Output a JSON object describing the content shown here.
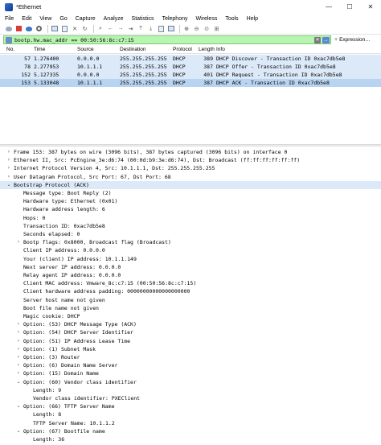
{
  "window": {
    "title": "*Ethernet",
    "controls": [
      "—",
      "☐",
      "✕"
    ]
  },
  "menu": [
    "File",
    "Edit",
    "View",
    "Go",
    "Capture",
    "Analyze",
    "Statistics",
    "Telephony",
    "Wireless",
    "Tools",
    "Help"
  ],
  "filter": {
    "value": "bootp.hw.mac_addr == 00:50:56:8c:c7:15",
    "expression_label": "Expression…",
    "clear_glyph": "✕",
    "apply_glyph": "→"
  },
  "packet_list": {
    "columns": [
      "No.",
      "Time",
      "Source",
      "Destination",
      "Protocol",
      "Length",
      "Info"
    ],
    "rows": [
      {
        "no": "57",
        "time": "1.276400",
        "src": "0.0.0.0",
        "dst": "255.255.255.255",
        "proto": "DHCP",
        "len": "389",
        "info": "DHCP Discover  - Transaction ID 0xac7db5e8",
        "selected": false
      },
      {
        "no": "78",
        "time": "2.277953",
        "src": "10.1.1.1",
        "dst": "255.255.255.255",
        "proto": "DHCP",
        "len": "387",
        "info": "DHCP Offer     - Transaction ID 0xac7db5e8",
        "selected": false
      },
      {
        "no": "152",
        "time": "5.127335",
        "src": "0.0.0.0",
        "dst": "255.255.255.255",
        "proto": "DHCP",
        "len": "401",
        "info": "DHCP Request   - Transaction ID 0xac7db5e8",
        "selected": false
      },
      {
        "no": "153",
        "time": "5.133048",
        "src": "10.1.1.1",
        "dst": "255.255.255.255",
        "proto": "DHCP",
        "len": "387",
        "info": "DHCP ACK       - Transaction ID 0xac7db5e8",
        "selected": true
      }
    ]
  },
  "details": [
    {
      "indent": 0,
      "arrow": "›",
      "text": "Frame 153: 387 bytes on wire (3096 bits), 387 bytes captured (3096 bits) on interface 0",
      "hl": false
    },
    {
      "indent": 0,
      "arrow": "›",
      "text": "Ethernet II, Src: PcEngine_3e:d6:74 (00:0d:b9:3e:d6:74), Dst: Broadcast (ff:ff:ff:ff:ff:ff)",
      "hl": false
    },
    {
      "indent": 0,
      "arrow": "›",
      "text": "Internet Protocol Version 4, Src: 10.1.1.1, Dst: 255.255.255.255",
      "hl": false
    },
    {
      "indent": 0,
      "arrow": "›",
      "text": "User Datagram Protocol, Src Port: 67, Dst Port: 68",
      "hl": false
    },
    {
      "indent": 0,
      "arrow": "⌄",
      "text": "Bootstrap Protocol (ACK)",
      "hl": true
    },
    {
      "indent": 1,
      "arrow": "",
      "text": "Message type: Boot Reply (2)",
      "hl": false
    },
    {
      "indent": 1,
      "arrow": "",
      "text": "Hardware type: Ethernet (0x01)",
      "hl": false
    },
    {
      "indent": 1,
      "arrow": "",
      "text": "Hardware address length: 6",
      "hl": false
    },
    {
      "indent": 1,
      "arrow": "",
      "text": "Hops: 0",
      "hl": false
    },
    {
      "indent": 1,
      "arrow": "",
      "text": "Transaction ID: 0xac7db5e8",
      "hl": false
    },
    {
      "indent": 1,
      "arrow": "",
      "text": "Seconds elapsed: 0",
      "hl": false
    },
    {
      "indent": 1,
      "arrow": "›",
      "text": "Bootp flags: 0x8000, Broadcast flag (Broadcast)",
      "hl": false
    },
    {
      "indent": 1,
      "arrow": "",
      "text": "Client IP address: 0.0.0.0",
      "hl": false
    },
    {
      "indent": 1,
      "arrow": "",
      "text": "Your (client) IP address: 10.1.1.149",
      "hl": false
    },
    {
      "indent": 1,
      "arrow": "",
      "text": "Next server IP address: 0.0.0.0",
      "hl": false
    },
    {
      "indent": 1,
      "arrow": "",
      "text": "Relay agent IP address: 0.0.0.0",
      "hl": false
    },
    {
      "indent": 1,
      "arrow": "",
      "text": "Client MAC address: Vmware_8c:c7:15 (00:50:56:8c:c7:15)",
      "hl": false
    },
    {
      "indent": 1,
      "arrow": "",
      "text": "Client hardware address padding: 00000000000000000000",
      "hl": false
    },
    {
      "indent": 1,
      "arrow": "",
      "text": "Server host name not given",
      "hl": false
    },
    {
      "indent": 1,
      "arrow": "",
      "text": "Boot file name not given",
      "hl": false
    },
    {
      "indent": 1,
      "arrow": "",
      "text": "Magic cookie: DHCP",
      "hl": false
    },
    {
      "indent": 1,
      "arrow": "›",
      "text": "Option: (53) DHCP Message Type (ACK)",
      "hl": false
    },
    {
      "indent": 1,
      "arrow": "›",
      "text": "Option: (54) DHCP Server Identifier",
      "hl": false
    },
    {
      "indent": 1,
      "arrow": "›",
      "text": "Option: (51) IP Address Lease Time",
      "hl": false
    },
    {
      "indent": 1,
      "arrow": "›",
      "text": "Option: (1) Subnet Mask",
      "hl": false
    },
    {
      "indent": 1,
      "arrow": "›",
      "text": "Option: (3) Router",
      "hl": false
    },
    {
      "indent": 1,
      "arrow": "›",
      "text": "Option: (6) Domain Name Server",
      "hl": false
    },
    {
      "indent": 1,
      "arrow": "›",
      "text": "Option: (15) Domain Name",
      "hl": false
    },
    {
      "indent": 1,
      "arrow": "⌄",
      "text": "Option: (60) Vendor class identifier",
      "hl": false
    },
    {
      "indent": 2,
      "arrow": "",
      "text": "Length: 9",
      "hl": false
    },
    {
      "indent": 2,
      "arrow": "",
      "text": "Vendor class identifier: PXEClient",
      "hl": false
    },
    {
      "indent": 1,
      "arrow": "⌄",
      "text": "Option: (66) TFTP Server Name",
      "hl": false
    },
    {
      "indent": 2,
      "arrow": "",
      "text": "Length: 8",
      "hl": false
    },
    {
      "indent": 2,
      "arrow": "",
      "text": "TFTP Server Name: 10.1.1.2",
      "hl": false
    },
    {
      "indent": 1,
      "arrow": "⌄",
      "text": "Option: (67) Bootfile name",
      "hl": false
    },
    {
      "indent": 2,
      "arrow": "",
      "text": "Length: 36",
      "hl": false
    },
    {
      "indent": 2,
      "arrow": "",
      "text": "Bootfile name: /volume1/PXE/ipxe-snponly-x86-64.efi",
      "hl": false
    },
    {
      "indent": 1,
      "arrow": "›",
      "text": "Option: (255) End",
      "hl": false
    }
  ]
}
